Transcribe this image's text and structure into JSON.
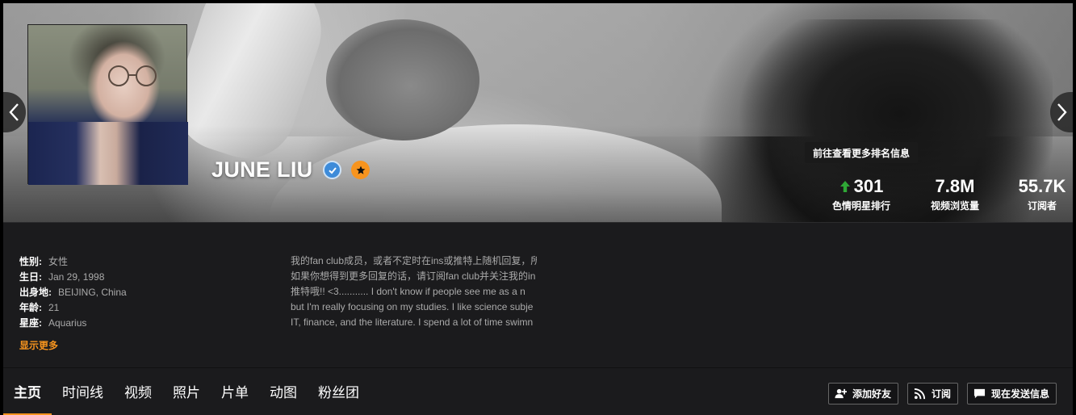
{
  "profile": {
    "name": "JUNE LIU"
  },
  "tooltip": "前往查看更多排名信息",
  "stats": {
    "rank": {
      "value": "301",
      "label": "色情明星排行"
    },
    "views": {
      "value": "7.8M",
      "label": "视频浏览量"
    },
    "subscribers": {
      "value": "55.7K",
      "label": "订阅者"
    }
  },
  "details": [
    {
      "key": "性别:",
      "value": "女性"
    },
    {
      "key": "生日:",
      "value": "Jan 29, 1998"
    },
    {
      "key": "出身地:",
      "value": "BEIJING, China"
    },
    {
      "key": "年龄:",
      "value": "21"
    },
    {
      "key": "星座:",
      "value": "Aquarius"
    }
  ],
  "show_more": "显示更多",
  "bio_lines": [
    "我的fan club成员，或者不定时在ins或推特上随机回复，所",
    "如果你想得到更多回复的话，请订阅fan club并关注我的in",
    "推特哦!! <3........... I don't know if people see me as a n",
    "but I'm really focusing on my studies. I like science subje",
    "IT, finance, and the literature. I spend a lot of time swimn"
  ],
  "tabs": [
    "主页",
    "时间线",
    "视频",
    "照片",
    "片单",
    "动图",
    "粉丝团"
  ],
  "actions": {
    "add_friend": "添加好友",
    "subscribe": "订阅",
    "send_message": "现在发送信息"
  },
  "colors": {
    "accent": "#f7941e",
    "verified": "#3d8bd9",
    "rank_up": "#2fa836",
    "panel_bg": "#1b1b1d"
  },
  "icons": {
    "prev": "chevron-left-icon",
    "next": "chevron-right-icon",
    "verified": "verified-check-icon",
    "badge": "star-badge-icon",
    "rank_trend": "arrow-up-icon",
    "add_friend": "add-user-icon",
    "subscribe": "rss-icon",
    "message": "chat-bubble-icon"
  }
}
